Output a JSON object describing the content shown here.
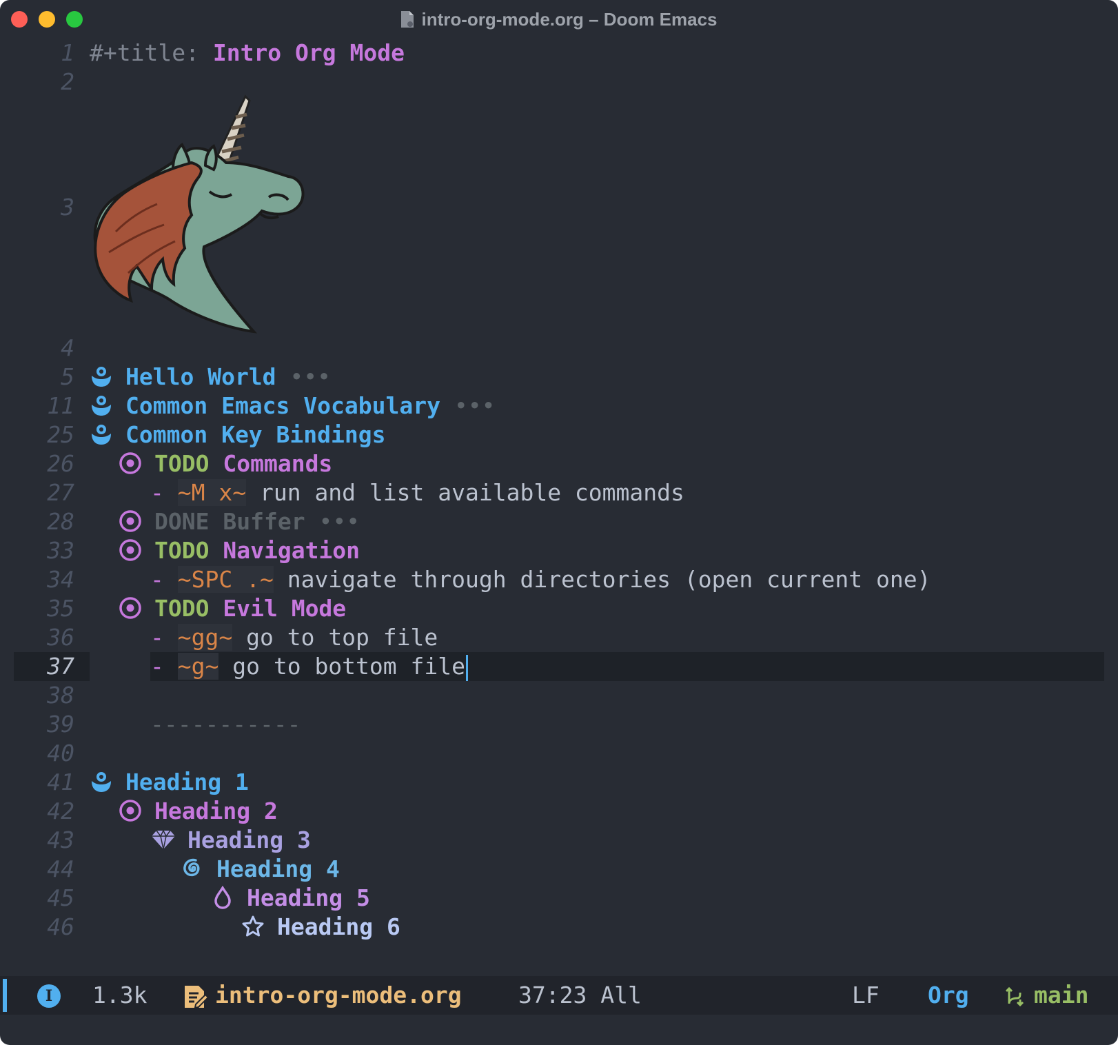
{
  "window": {
    "title": "intro-org-mode.org – Doom Emacs",
    "traffic_lights": [
      "close",
      "minimize",
      "maximize"
    ]
  },
  "editor": {
    "lines": {
      "l1": {
        "num": "1",
        "kw": "#+title:",
        "title": "Intro Org Mode"
      },
      "l2": {
        "num": "2"
      },
      "l3": {
        "num": "3",
        "image": "unicorn-logo"
      },
      "l4": {
        "num": "4"
      },
      "l5": {
        "num": "5",
        "icon": "h1-bullet-icon",
        "text": "Hello World",
        "ellipsis": "•••"
      },
      "l11": {
        "num": "11",
        "icon": "h1-bullet-icon",
        "text": "Common Emacs Vocabulary",
        "ellipsis": "•••"
      },
      "l25": {
        "num": "25",
        "icon": "h1-bullet-icon",
        "text": "Common Key Bindings"
      },
      "l26": {
        "num": "26",
        "icon": "h2-bullet-icon",
        "keyword": "TODO",
        "text": "Commands"
      },
      "l27": {
        "num": "27",
        "dash": "-",
        "code": "~M x~",
        "text": "run and list available commands"
      },
      "l28": {
        "num": "28",
        "icon": "h2-bullet-icon",
        "keyword": "DONE",
        "text": "Buffer",
        "ellipsis": "•••"
      },
      "l33": {
        "num": "33",
        "icon": "h2-bullet-icon",
        "keyword": "TODO",
        "text": "Navigation"
      },
      "l34": {
        "num": "34",
        "dash": "-",
        "code": "~SPC .~",
        "text": "navigate through directories (open current one)"
      },
      "l35": {
        "num": "35",
        "icon": "h2-bullet-icon",
        "keyword": "TODO",
        "text": "Evil Mode"
      },
      "l36": {
        "num": "36",
        "dash": "-",
        "code": "~gg~",
        "text": "go to top file"
      },
      "l37": {
        "num": "37",
        "dash": "-",
        "code": "~g~",
        "text": "go to bottom file"
      },
      "l38": {
        "num": "38"
      },
      "l39": {
        "num": "39",
        "rule": "-----------"
      },
      "l40": {
        "num": "40"
      },
      "l41": {
        "num": "41",
        "icon": "h1-bullet-icon",
        "text": "Heading 1"
      },
      "l42": {
        "num": "42",
        "icon": "h2-bullet-icon",
        "text": "Heading 2"
      },
      "l43": {
        "num": "43",
        "icon": "diamond-icon",
        "text": "Heading 3"
      },
      "l44": {
        "num": "44",
        "icon": "spiral-icon",
        "text": "Heading 4"
      },
      "l45": {
        "num": "45",
        "icon": "drop-icon",
        "text": "Heading 5"
      },
      "l46": {
        "num": "46",
        "icon": "star-icon",
        "text": "Heading 6"
      }
    },
    "current_line": "37"
  },
  "modeline": {
    "info_glyph": "I",
    "size": "1.3k",
    "filename": "intro-org-mode.org",
    "position": "37:23 All",
    "eol": "LF",
    "major_mode": "Org",
    "branch": "main"
  },
  "colors": {
    "background": "#282c34",
    "heading1": "#51afef",
    "heading2": "#c678dd",
    "todo": "#98be65",
    "code": "#da8548",
    "filename": "#ecbe7b"
  }
}
